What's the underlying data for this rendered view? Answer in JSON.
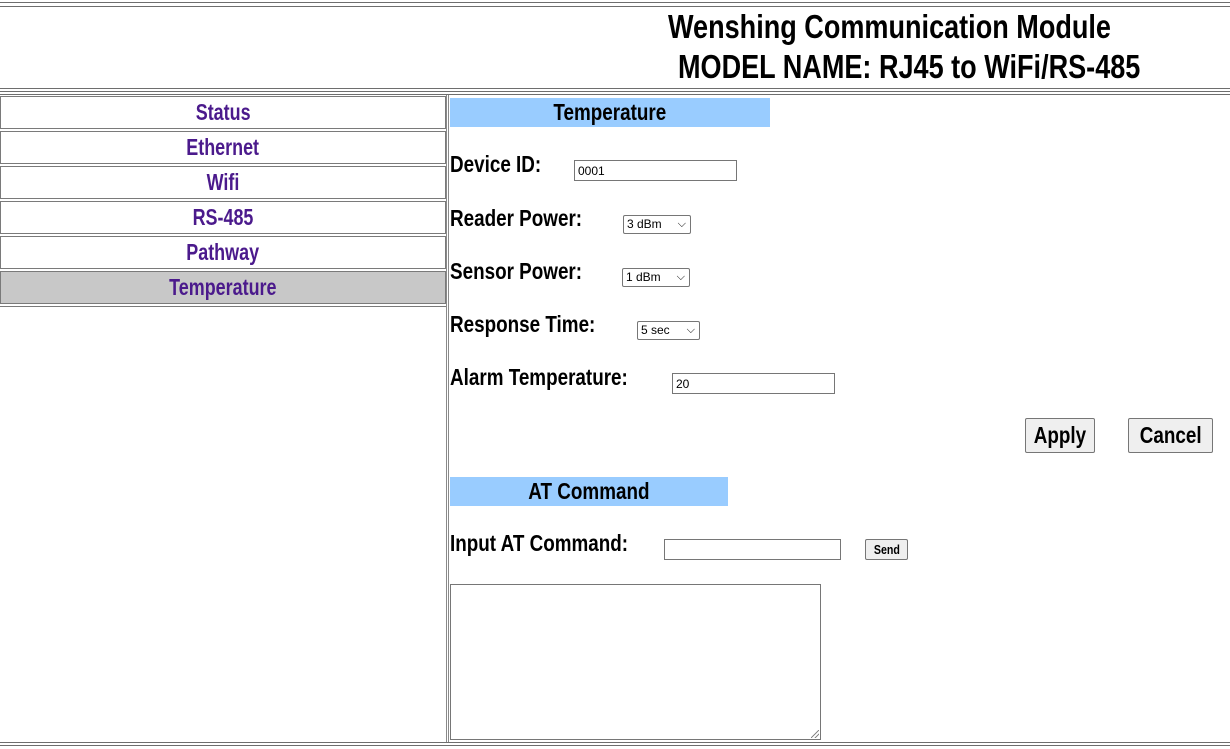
{
  "header": {
    "title": "Wenshing Communication Module",
    "model": "MODEL NAME: RJ45 to WiFi/RS-485"
  },
  "sidebar": {
    "items": [
      {
        "label": "Status"
      },
      {
        "label": "Ethernet"
      },
      {
        "label": "Wifi"
      },
      {
        "label": "RS-485"
      },
      {
        "label": "Pathway"
      },
      {
        "label": "Temperature"
      }
    ],
    "active": "Temperature"
  },
  "temperature": {
    "section_title": "Temperature",
    "device_id_label": "Device ID:",
    "device_id_value": "0001",
    "reader_power_label": "Reader Power:",
    "reader_power_value": "3 dBm",
    "sensor_power_label": "Sensor Power:",
    "sensor_power_value": "1 dBm",
    "response_time_label": "Response Time:",
    "response_time_value": "5 sec",
    "alarm_temp_label": "Alarm Temperature:",
    "alarm_temp_value": "20",
    "apply_label": "Apply",
    "cancel_label": "Cancel"
  },
  "at_command": {
    "section_title": "AT Command",
    "input_label": "Input AT Command:",
    "input_value": "",
    "send_label": "Send",
    "output_value": ""
  },
  "colors": {
    "section_bar": "#99ccff",
    "nav_text": "#4b1a8c",
    "nav_active_bg": "#c8c8c8"
  }
}
